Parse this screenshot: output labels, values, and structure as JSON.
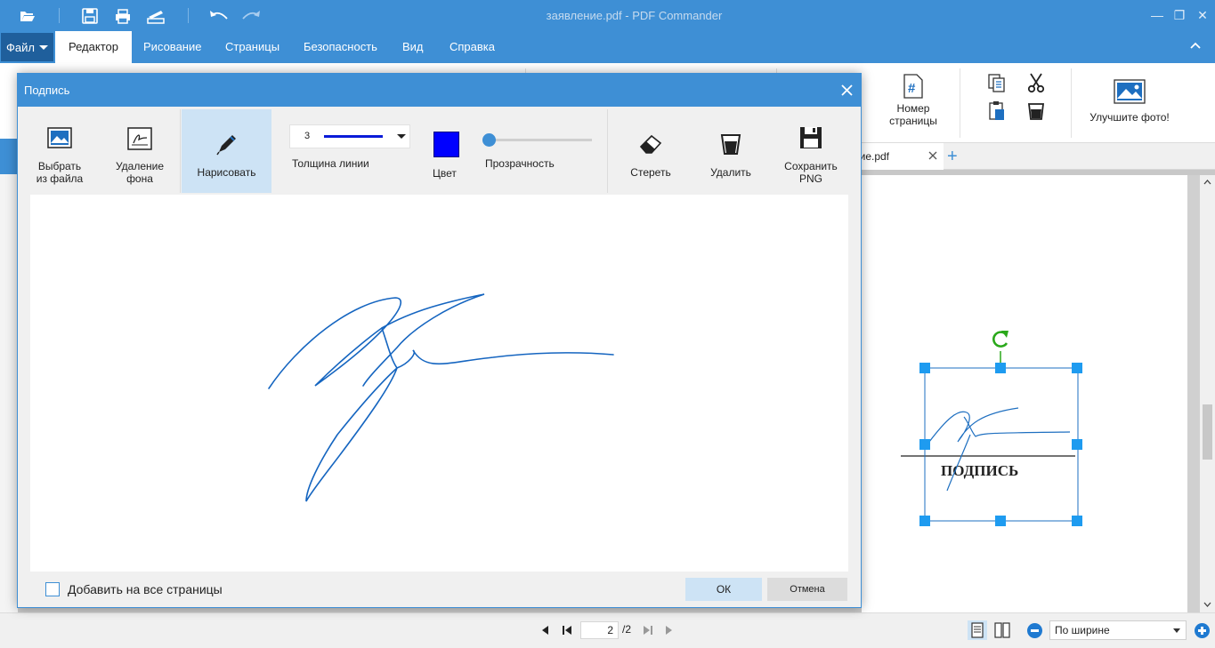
{
  "window": {
    "title": "заявление.pdf - PDF Commander"
  },
  "menu": {
    "file": "Файл",
    "tabs": [
      "Редактор",
      "Рисование",
      "Страницы",
      "Безопасность",
      "Вид",
      "Справка"
    ]
  },
  "ribbon": {
    "page_number_label_1": "Номер",
    "page_number_label_2": "страницы",
    "improve_photo": "Улучшите фото!"
  },
  "doc_tab": {
    "name": "ние.pdf"
  },
  "document": {
    "signature_caption": "ПОДПИСЬ"
  },
  "status": {
    "page_current": "2",
    "page_total": "/2",
    "zoom_mode": "По ширине"
  },
  "dialog": {
    "title": "Подпись",
    "tools": {
      "from_file_1": "Выбрать",
      "from_file_2": "из файла",
      "remove_bg_1": "Удаление",
      "remove_bg_2": "фона",
      "draw": "Нарисовать",
      "erase": "Стереть",
      "delete": "Удалить",
      "save_png_1": "Сохранить",
      "save_png_2": "PNG"
    },
    "line_thickness_value": "3",
    "line_thickness_label": "Толщина линии",
    "color_label": "Цвет",
    "color_value": "#0000ff",
    "transparency_label": "Прозрачность",
    "transparency_value": 0,
    "apply_all_pages": "Добавить на все страницы",
    "ok": "ОК",
    "cancel": "Отмена"
  },
  "colors": {
    "accent": "#3e8fd5",
    "signature_ink": "#1565c0",
    "handle": "#1e9bf0",
    "rotate_handle": "#2aa81a"
  }
}
